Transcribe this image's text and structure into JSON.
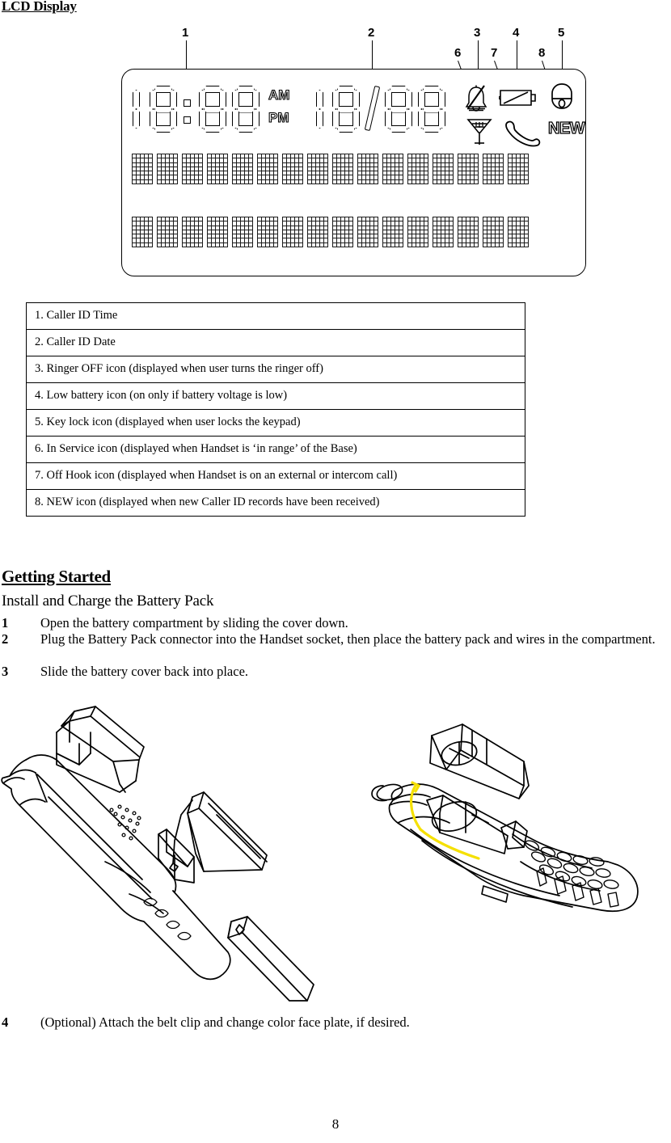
{
  "document": {
    "page_number": "8"
  },
  "lcd_section": {
    "heading": "LCD Display",
    "figure": {
      "callouts": [
        {
          "id": "1",
          "label": "1"
        },
        {
          "id": "2",
          "label": "2"
        },
        {
          "id": "3",
          "label": "3"
        },
        {
          "id": "4",
          "label": "4"
        },
        {
          "id": "5",
          "label": "5"
        },
        {
          "id": "6",
          "label": "6"
        },
        {
          "id": "7",
          "label": "7"
        },
        {
          "id": "8",
          "label": "8"
        }
      ],
      "time_display": {
        "digits": "18:88",
        "am_label": "AM",
        "pm_label": "PM"
      },
      "date_display": {
        "digits": "18/88",
        "separator": "/"
      },
      "status_icons": [
        {
          "name": "ringer-off-icon",
          "callout": "3"
        },
        {
          "name": "low-battery-icon",
          "callout": "4"
        },
        {
          "name": "key-lock-icon",
          "callout": "5"
        },
        {
          "name": "in-service-icon",
          "callout": "6"
        },
        {
          "name": "off-hook-icon",
          "callout": "7"
        },
        {
          "name": "new-icon",
          "callout": "8",
          "text": "NEW"
        }
      ],
      "dot_matrix": {
        "rows": 2,
        "cells_per_row": 16,
        "dots_wide": 5,
        "dots_tall": 7
      }
    },
    "table_rows": [
      {
        "text": "1. Caller ID Time"
      },
      {
        "text": "2. Caller ID Date"
      },
      {
        "text": "3. Ringer OFF icon (displayed when user turns the ringer off)"
      },
      {
        "text": "4. Low battery icon (on only if battery voltage is low)"
      },
      {
        "text": "5. Key lock icon (displayed when user locks the keypad)"
      },
      {
        "text": "6. In Service icon (displayed when Handset is ‘in range’ of the Base)"
      },
      {
        "text": "7. Off Hook icon (displayed when Handset is on an external or intercom call)"
      },
      {
        "text": "8. NEW icon (displayed when new Caller ID records have been received)"
      }
    ]
  },
  "getting_started": {
    "heading": "Getting Started",
    "subheading": "Install and Charge the Battery Pack",
    "steps": [
      {
        "number": "1",
        "text": "Open the battery compartment by sliding the cover down."
      },
      {
        "number": "2",
        "text": "Plug the Battery Pack connector into the Handset socket, then place the battery pack and wires in the compartment."
      },
      {
        "number": "3",
        "text": "Slide the battery cover back into place."
      },
      {
        "number": "4",
        "text": "(Optional)  Attach the belt clip and change color face plate, if desired."
      }
    ]
  },
  "colors": {
    "ink": "#000000",
    "paper": "#ffffff",
    "highlight_wire": "#f5e000"
  }
}
